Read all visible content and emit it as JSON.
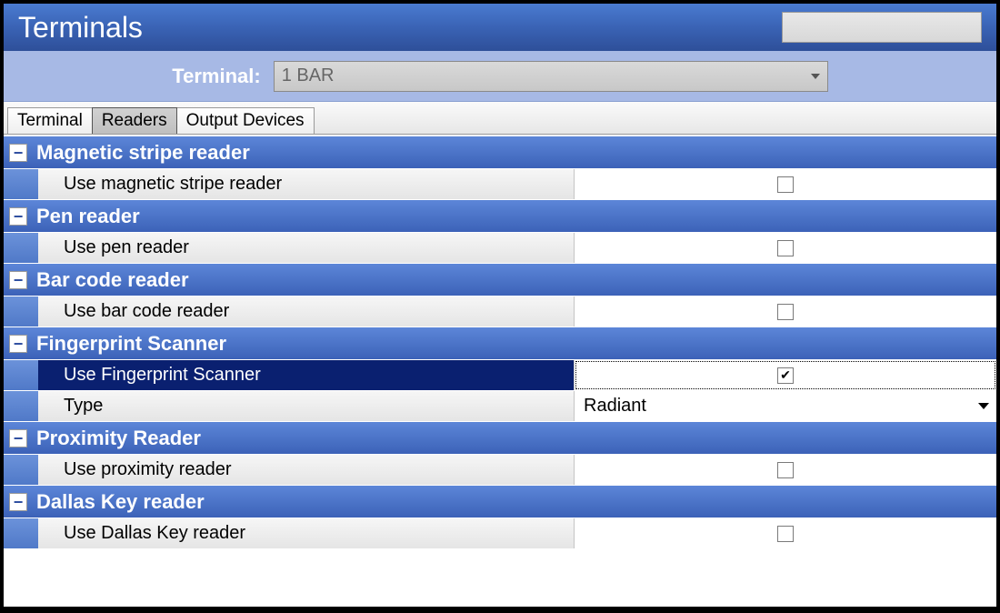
{
  "titlebar": {
    "title": "Terminals"
  },
  "toolbar": {
    "label": "Terminal:",
    "selected": "1 BAR"
  },
  "tabs": [
    {
      "label": "Terminal",
      "active": false
    },
    {
      "label": "Readers",
      "active": true
    },
    {
      "label": "Output Devices",
      "active": false
    }
  ],
  "sections": {
    "mag": {
      "title": "Magnetic stripe reader",
      "row_label": "Use magnetic stripe reader",
      "checked": false
    },
    "pen": {
      "title": "Pen reader",
      "row_label": "Use pen reader",
      "checked": false
    },
    "bar": {
      "title": "Bar code reader",
      "row_label": "Use bar code reader",
      "checked": false
    },
    "fp": {
      "title": "Fingerprint Scanner",
      "row_label": "Use Fingerprint Scanner",
      "checked": true,
      "type_label": "Type",
      "type_value": "Radiant"
    },
    "prox": {
      "title": "Proximity Reader",
      "row_label": "Use proximity reader",
      "checked": false
    },
    "dallas": {
      "title": "Dallas Key reader",
      "row_label": "Use Dallas Key reader",
      "checked": false
    }
  },
  "glyphs": {
    "minus": "−",
    "check": "✔"
  }
}
